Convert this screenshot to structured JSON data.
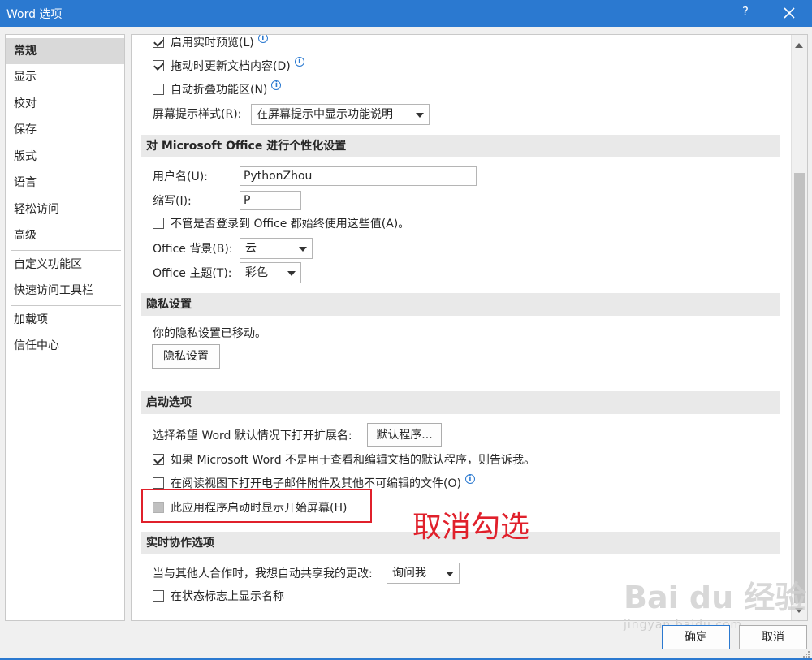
{
  "window": {
    "title": "Word 选项",
    "help_label": "?",
    "close_icon": "close-icon"
  },
  "nav": {
    "items": [
      "常规",
      "显示",
      "校对",
      "保存",
      "版式",
      "语言",
      "轻松访问",
      "高级"
    ],
    "items2": [
      "自定义功能区",
      "快速访问工具栏"
    ],
    "items3": [
      "加载项",
      "信任中心"
    ],
    "active": "常规"
  },
  "ui_options": {
    "live_preview": {
      "label": "启用实时预览(L)",
      "checked": true
    },
    "drag_update": {
      "label": "拖动时更新文档内容(D)",
      "checked": true
    },
    "collapse_ribbon": {
      "label": "自动折叠功能区(N)",
      "checked": false
    },
    "tooltip_style_label": "屏幕提示样式(R):",
    "tooltip_style_value": "在屏幕提示中显示功能说明"
  },
  "personalize": {
    "header": "对 Microsoft Office 进行个性化设置",
    "username_label": "用户名(U):",
    "username_value": "PythonZhou",
    "initials_label": "缩写(I):",
    "initials_value": "P",
    "always_use_label": "不管是否登录到 Office 都始终使用这些值(A)。",
    "always_use_checked": false,
    "background_label": "Office 背景(B):",
    "background_value": "云",
    "theme_label": "Office 主题(T):",
    "theme_value": "彩色"
  },
  "privacy": {
    "header": "隐私设置",
    "moved_text": "你的隐私设置已移动。",
    "button_label": "隐私设置"
  },
  "startup": {
    "header": "启动选项",
    "extensions_label": "选择希望 Word 默认情况下打开扩展名:",
    "default_programs_button": "默认程序...",
    "notify_default": {
      "label": "如果 Microsoft Word 不是用于查看和编辑文档的默认程序，则告诉我。",
      "checked": true
    },
    "open_attachments": {
      "label": "在阅读视图下打开电子邮件附件及其他不可编辑的文件(O)",
      "checked": false
    },
    "show_start_screen": {
      "label": "此应用程序启动时显示开始屏幕(H)",
      "checked": false
    }
  },
  "coauthoring": {
    "header": "实时协作选项",
    "share_label": "当与其他人合作时，我想自动共享我的更改:",
    "share_value": "询问我",
    "show_names": {
      "label": "在状态标志上显示名称",
      "checked": false
    }
  },
  "annotation": {
    "text": "取消勾选",
    "color": "#e0202b"
  },
  "footer": {
    "ok_label": "确定",
    "cancel_label": "取消"
  },
  "watermark": {
    "text": "Bai du 经验",
    "sub": "jingyan.baidu.com"
  },
  "colors": {
    "accent": "#2b79d0",
    "section_bg": "#e9e9e9"
  }
}
